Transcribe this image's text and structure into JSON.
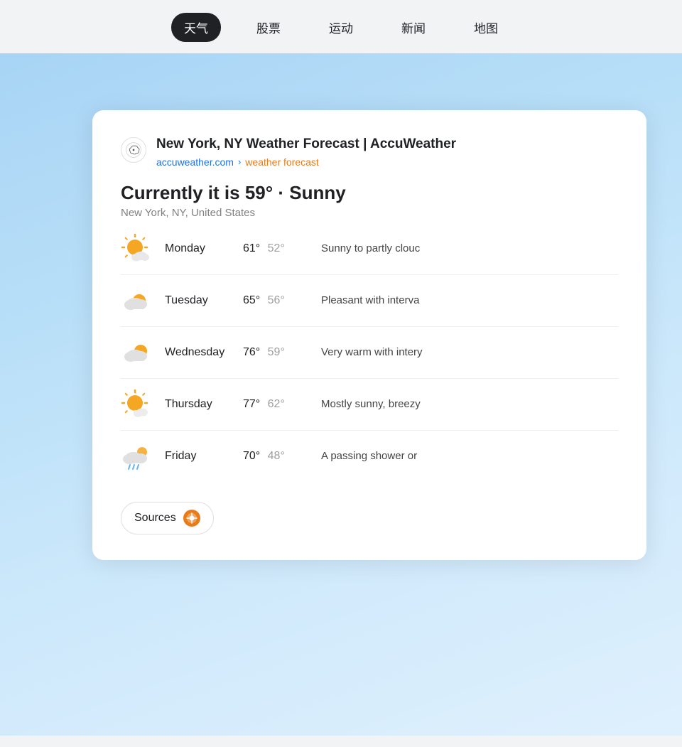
{
  "nav": {
    "items": [
      {
        "label": "天气",
        "active": true
      },
      {
        "label": "股票",
        "active": false
      },
      {
        "label": "运动",
        "active": false
      },
      {
        "label": "新闻",
        "active": false
      },
      {
        "label": "地图",
        "active": false
      }
    ]
  },
  "card": {
    "site_title": "New York, NY Weather Forecast | AccuWeather",
    "breadcrumb_main": "accuweather.com",
    "breadcrumb_sep": "›",
    "breadcrumb_sub": "weather forecast",
    "current_temp": "Currently it is 59° · Sunny",
    "current_location": "New York, NY, United States",
    "forecast": [
      {
        "day": "Monday",
        "high": "61°",
        "low": "52°",
        "desc": "Sunny to partly clouc",
        "icon": "partly-sunny"
      },
      {
        "day": "Tuesday",
        "high": "65°",
        "low": "56°",
        "desc": "Pleasant with interva",
        "icon": "partly-cloudy"
      },
      {
        "day": "Wednesday",
        "high": "76°",
        "low": "59°",
        "desc": "Very warm with intery",
        "icon": "partly-cloudy"
      },
      {
        "day": "Thursday",
        "high": "77°",
        "low": "62°",
        "desc": "Mostly sunny, breezy",
        "icon": "partly-sunny-small"
      },
      {
        "day": "Friday",
        "high": "70°",
        "low": "48°",
        "desc": "A passing shower or",
        "icon": "rainy"
      }
    ],
    "sources_label": "Sources"
  }
}
